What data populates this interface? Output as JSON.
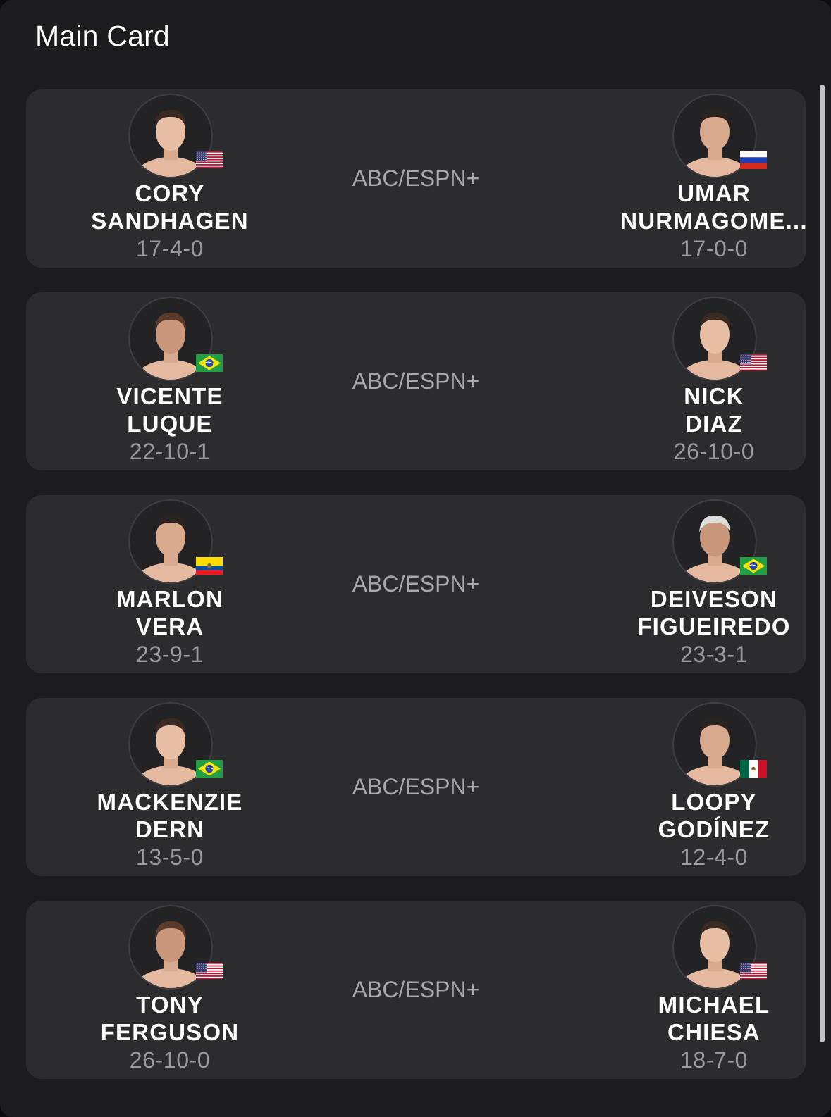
{
  "header": {
    "title": "Main Card"
  },
  "colors": {
    "background": "#1c1c1e",
    "card": "#2c2c2e",
    "text_primary": "#ffffff",
    "text_secondary": "#9a9a9f"
  },
  "fights": [
    {
      "broadcast": "ABC/ESPN+",
      "left": {
        "first": "CORY",
        "last": "SANDHAGEN",
        "record": "17-4-0",
        "flag": "us-flag-icon"
      },
      "right": {
        "first": "UMAR",
        "last": "NURMAGOME...",
        "record": "17-0-0",
        "flag": "russia-flag-icon"
      }
    },
    {
      "broadcast": "ABC/ESPN+",
      "left": {
        "first": "VICENTE",
        "last": "LUQUE",
        "record": "22-10-1",
        "flag": "brazil-flag-icon"
      },
      "right": {
        "first": "NICK",
        "last": "DIAZ",
        "record": "26-10-0",
        "flag": "us-flag-icon"
      }
    },
    {
      "broadcast": "ABC/ESPN+",
      "left": {
        "first": "MARLON",
        "last": "VERA",
        "record": "23-9-1",
        "flag": "ecuador-flag-icon"
      },
      "right": {
        "first": "DEIVESON",
        "last": "FIGUEIREDO",
        "record": "23-3-1",
        "flag": "brazil-flag-icon"
      }
    },
    {
      "broadcast": "ABC/ESPN+",
      "left": {
        "first": "MACKENZIE",
        "last": "DERN",
        "record": "13-5-0",
        "flag": "brazil-flag-icon"
      },
      "right": {
        "first": "LOOPY",
        "last": "GODÍNEZ",
        "record": "12-4-0",
        "flag": "mexico-flag-icon"
      }
    },
    {
      "broadcast": "ABC/ESPN+",
      "left": {
        "first": "TONY",
        "last": "FERGUSON",
        "record": "26-10-0",
        "flag": "us-flag-icon"
      },
      "right": {
        "first": "MICHAEL",
        "last": "CHIESA",
        "record": "18-7-0",
        "flag": "us-flag-icon"
      }
    }
  ]
}
